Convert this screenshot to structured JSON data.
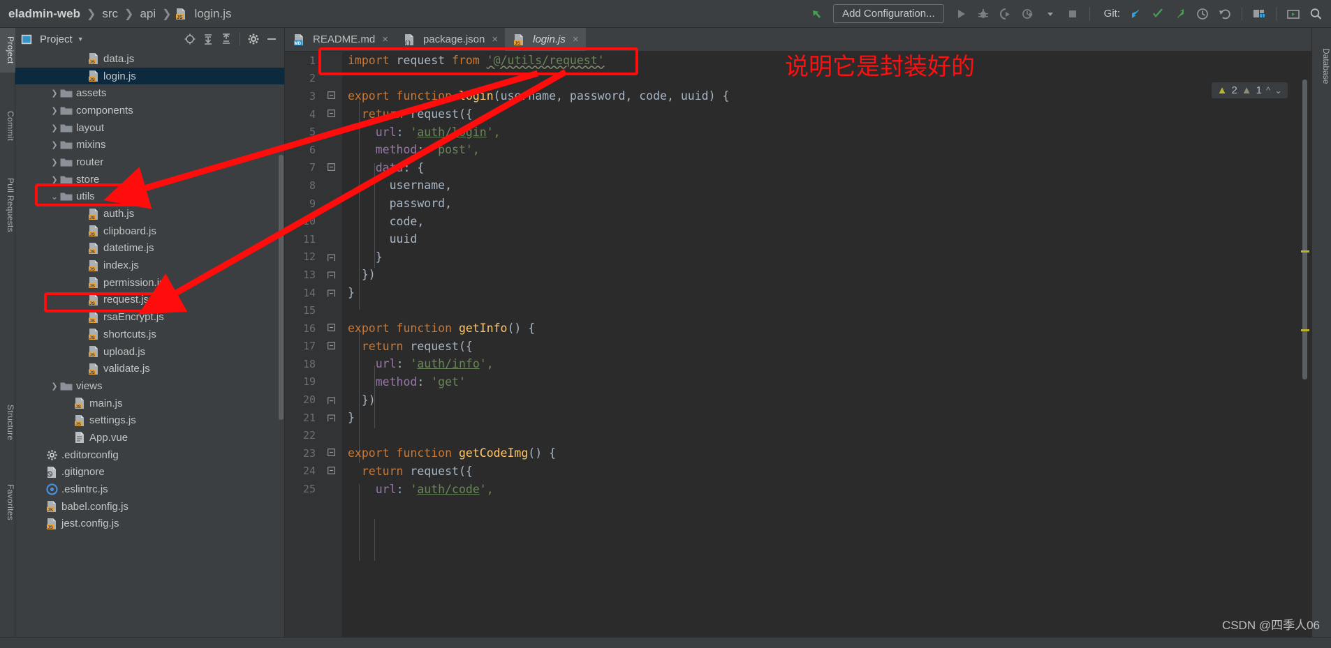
{
  "window": {
    "breadcrumb": [
      "eladmin-web",
      "src",
      "api",
      "login.js"
    ],
    "breadcrumb_file_icon": "js-file-icon"
  },
  "toolbar": {
    "back_icon": "green-arrow-up-left-icon",
    "add_configuration": "Add Configuration...",
    "run_icon": "run-play-icon",
    "debug_icon": "debug-bug-icon",
    "run_coverage_icon": "run-with-coverage-icon",
    "profile_icon": "profiler-icon",
    "dropdown_icon": "chevron-down-icon",
    "stop_icon": "stop-square-icon",
    "git_label": "Git:",
    "git_update_icon": "update-project-blue-arrow-icon",
    "git_commit_icon": "commit-green-check-icon",
    "git_push_icon": "push-green-arrow-icon",
    "history_icon": "history-clock-icon",
    "rollback_icon": "rollback-undo-icon",
    "layout_icon": "layout-windows-icon",
    "terminal_icon": "terminal-screen-icon",
    "search_icon": "search-magnifier-icon"
  },
  "left_tool_strip": [
    {
      "label": "Project",
      "active": true
    },
    {
      "label": "Commit",
      "active": false
    },
    {
      "label": "Pull Requests",
      "active": false
    },
    {
      "label": "Structure",
      "active": false
    },
    {
      "label": "Favorites",
      "active": false
    }
  ],
  "right_tool_strip": [
    {
      "label": "Database"
    }
  ],
  "project_panel": {
    "title": "Project",
    "title_icon": "project-window-icon",
    "caret_icon": "chevron-down-icon",
    "actions": [
      {
        "name": "select-opened-file-icon",
        "glyph": "locate"
      },
      {
        "name": "expand-all-icon",
        "glyph": "expand"
      },
      {
        "name": "collapse-all-icon",
        "glyph": "collapse"
      },
      {
        "name": "settings-gear-icon",
        "glyph": "gear"
      },
      {
        "name": "hide-panel-icon",
        "glyph": "minus"
      }
    ]
  },
  "tree": [
    {
      "label": "data.js",
      "icon": "js-file-icon",
      "indent": 4,
      "arrow": "none",
      "selected": false
    },
    {
      "label": "login.js",
      "icon": "js-file-icon",
      "indent": 4,
      "arrow": "none",
      "selected": true
    },
    {
      "label": "assets",
      "icon": "folder-icon",
      "indent": 2,
      "arrow": "right",
      "selected": false
    },
    {
      "label": "components",
      "icon": "folder-icon",
      "indent": 2,
      "arrow": "right",
      "selected": false
    },
    {
      "label": "layout",
      "icon": "folder-icon",
      "indent": 2,
      "arrow": "right",
      "selected": false
    },
    {
      "label": "mixins",
      "icon": "folder-icon",
      "indent": 2,
      "arrow": "right",
      "selected": false
    },
    {
      "label": "router",
      "icon": "folder-icon",
      "indent": 2,
      "arrow": "right",
      "selected": false
    },
    {
      "label": "store",
      "icon": "folder-icon",
      "indent": 2,
      "arrow": "right",
      "selected": false
    },
    {
      "label": "utils",
      "icon": "folder-icon",
      "indent": 2,
      "arrow": "down",
      "selected": false
    },
    {
      "label": "auth.js",
      "icon": "js-file-icon",
      "indent": 4,
      "arrow": "none",
      "selected": false
    },
    {
      "label": "clipboard.js",
      "icon": "js-file-icon",
      "indent": 4,
      "arrow": "none",
      "selected": false
    },
    {
      "label": "datetime.js",
      "icon": "js-file-icon",
      "indent": 4,
      "arrow": "none",
      "selected": false
    },
    {
      "label": "index.js",
      "icon": "js-file-icon",
      "indent": 4,
      "arrow": "none",
      "selected": false
    },
    {
      "label": "permission.js",
      "icon": "js-file-icon",
      "indent": 4,
      "arrow": "none",
      "selected": false
    },
    {
      "label": "request.js",
      "icon": "js-file-icon",
      "indent": 4,
      "arrow": "none",
      "selected": false
    },
    {
      "label": "rsaEncrypt.js",
      "icon": "js-file-icon",
      "indent": 4,
      "arrow": "none",
      "selected": false
    },
    {
      "label": "shortcuts.js",
      "icon": "js-file-icon",
      "indent": 4,
      "arrow": "none",
      "selected": false
    },
    {
      "label": "upload.js",
      "icon": "js-file-icon",
      "indent": 4,
      "arrow": "none",
      "selected": false
    },
    {
      "label": "validate.js",
      "icon": "js-file-icon",
      "indent": 4,
      "arrow": "none",
      "selected": false
    },
    {
      "label": "views",
      "icon": "folder-icon",
      "indent": 2,
      "arrow": "right",
      "selected": false
    },
    {
      "label": "main.js",
      "icon": "js-file-icon",
      "indent": 3,
      "arrow": "none",
      "selected": false
    },
    {
      "label": "settings.js",
      "icon": "js-file-icon",
      "indent": 3,
      "arrow": "none",
      "selected": false
    },
    {
      "label": "App.vue",
      "icon": "vue-file-icon",
      "indent": 3,
      "arrow": "none",
      "selected": false
    },
    {
      "label": ".editorconfig",
      "icon": "config-gear-icon",
      "indent": 1,
      "arrow": "none",
      "selected": false
    },
    {
      "label": ".gitignore",
      "icon": "gitignore-icon",
      "indent": 1,
      "arrow": "none",
      "selected": false
    },
    {
      "label": ".eslintrc.js",
      "icon": "eslint-icon",
      "indent": 1,
      "arrow": "none",
      "selected": false
    },
    {
      "label": "babel.config.js",
      "icon": "js-file-icon",
      "indent": 1,
      "arrow": "none",
      "selected": false
    },
    {
      "label": "jest.config.js",
      "icon": "js-file-icon",
      "indent": 1,
      "arrow": "none",
      "selected": false
    }
  ],
  "editor_tabs": [
    {
      "label": "README.md",
      "icon": "md-file-icon",
      "active": false,
      "close": "×"
    },
    {
      "label": "package.json",
      "icon": "json-file-icon",
      "active": false,
      "close": "×"
    },
    {
      "label": "login.js",
      "icon": "js-file-icon",
      "active": true,
      "close": "×"
    }
  ],
  "inspections": {
    "warning_icon": "warning-triangle-yellow-icon",
    "warning_count": "2",
    "weak_warning_icon": "warning-triangle-grey-icon",
    "weak_warning_count": "1",
    "prev_icon": "chevron-up-icon",
    "next_icon": "chevron-down-icon"
  },
  "code": {
    "language": "javascript",
    "lines": [
      {
        "n": "1",
        "fold": "",
        "tokens": [
          {
            "t": "import ",
            "c": "kw"
          },
          {
            "t": "request ",
            "c": "id"
          },
          {
            "t": "from ",
            "c": "kw"
          },
          {
            "t": "'@/utils/request'",
            "c": "wavy"
          }
        ]
      },
      {
        "n": "2",
        "fold": "",
        "tokens": []
      },
      {
        "n": "3",
        "fold": "-",
        "tokens": [
          {
            "t": "export function ",
            "c": "kw"
          },
          {
            "t": "login",
            "c": "fn"
          },
          {
            "t": "(",
            "c": "punc"
          },
          {
            "t": "username, password, code, uuid",
            "c": "param"
          },
          {
            "t": ") {",
            "c": "punc"
          }
        ]
      },
      {
        "n": "4",
        "fold": "-",
        "tokens": [
          {
            "t": "  ",
            "c": "id"
          },
          {
            "t": "return ",
            "c": "kw"
          },
          {
            "t": "request({",
            "c": "id"
          }
        ]
      },
      {
        "n": "5",
        "fold": "",
        "tokens": [
          {
            "t": "    ",
            "c": "id"
          },
          {
            "t": "url",
            "c": "prop"
          },
          {
            "t": ": ",
            "c": "punc"
          },
          {
            "t": "'",
            "c": "str"
          },
          {
            "t": "auth/login",
            "c": "link"
          },
          {
            "t": "',",
            "c": "str"
          }
        ]
      },
      {
        "n": "6",
        "fold": "",
        "tokens": [
          {
            "t": "    ",
            "c": "id"
          },
          {
            "t": "method",
            "c": "prop"
          },
          {
            "t": ": ",
            "c": "punc"
          },
          {
            "t": "'post',",
            "c": "str"
          }
        ]
      },
      {
        "n": "7",
        "fold": "-",
        "tokens": [
          {
            "t": "    ",
            "c": "id"
          },
          {
            "t": "data",
            "c": "prop"
          },
          {
            "t": ": {",
            "c": "punc"
          }
        ]
      },
      {
        "n": "8",
        "fold": "",
        "tokens": [
          {
            "t": "      username,",
            "c": "id"
          }
        ]
      },
      {
        "n": "9",
        "fold": "",
        "tokens": [
          {
            "t": "      password,",
            "c": "id"
          }
        ]
      },
      {
        "n": "10",
        "fold": "",
        "tokens": [
          {
            "t": "      code,",
            "c": "id"
          }
        ]
      },
      {
        "n": "11",
        "fold": "",
        "tokens": [
          {
            "t": "      uuid",
            "c": "id"
          }
        ]
      },
      {
        "n": "12",
        "fold": "+",
        "tokens": [
          {
            "t": "    }",
            "c": "punc"
          }
        ]
      },
      {
        "n": "13",
        "fold": "+",
        "tokens": [
          {
            "t": "  })",
            "c": "punc"
          }
        ]
      },
      {
        "n": "14",
        "fold": "+",
        "tokens": [
          {
            "t": "}",
            "c": "punc"
          }
        ]
      },
      {
        "n": "15",
        "fold": "",
        "tokens": []
      },
      {
        "n": "16",
        "fold": "-",
        "tokens": [
          {
            "t": "export function ",
            "c": "kw"
          },
          {
            "t": "getInfo",
            "c": "fn"
          },
          {
            "t": "() {",
            "c": "punc"
          }
        ]
      },
      {
        "n": "17",
        "fold": "-",
        "tokens": [
          {
            "t": "  ",
            "c": "id"
          },
          {
            "t": "return ",
            "c": "kw"
          },
          {
            "t": "request({",
            "c": "id"
          }
        ]
      },
      {
        "n": "18",
        "fold": "",
        "tokens": [
          {
            "t": "    ",
            "c": "id"
          },
          {
            "t": "url",
            "c": "prop"
          },
          {
            "t": ": ",
            "c": "punc"
          },
          {
            "t": "'",
            "c": "str"
          },
          {
            "t": "auth/info",
            "c": "link"
          },
          {
            "t": "',",
            "c": "str"
          }
        ]
      },
      {
        "n": "19",
        "fold": "",
        "tokens": [
          {
            "t": "    ",
            "c": "id"
          },
          {
            "t": "method",
            "c": "prop"
          },
          {
            "t": ": ",
            "c": "punc"
          },
          {
            "t": "'get'",
            "c": "str"
          }
        ]
      },
      {
        "n": "20",
        "fold": "+",
        "tokens": [
          {
            "t": "  })",
            "c": "punc"
          }
        ]
      },
      {
        "n": "21",
        "fold": "+",
        "tokens": [
          {
            "t": "}",
            "c": "punc"
          }
        ]
      },
      {
        "n": "22",
        "fold": "",
        "tokens": []
      },
      {
        "n": "23",
        "fold": "-",
        "tokens": [
          {
            "t": "export function ",
            "c": "kw"
          },
          {
            "t": "getCodeImg",
            "c": "fn"
          },
          {
            "t": "() {",
            "c": "punc"
          }
        ]
      },
      {
        "n": "24",
        "fold": "-",
        "tokens": [
          {
            "t": "  ",
            "c": "id"
          },
          {
            "t": "return ",
            "c": "kw"
          },
          {
            "t": "request({",
            "c": "id"
          }
        ]
      },
      {
        "n": "25",
        "fold": "",
        "tokens": [
          {
            "t": "    ",
            "c": "id"
          },
          {
            "t": "url",
            "c": "prop"
          },
          {
            "t": ": ",
            "c": "punc"
          },
          {
            "t": "'",
            "c": "str"
          },
          {
            "t": "auth/code",
            "c": "link"
          },
          {
            "t": "',",
            "c": "str"
          }
        ]
      }
    ]
  },
  "annotations": {
    "note_text": "说明它是封装好的",
    "note_color": "#ff0f0f",
    "boxes": [
      {
        "name": "import-line-highlight"
      },
      {
        "name": "utils-folder-highlight"
      },
      {
        "name": "request-js-highlight"
      }
    ],
    "arrows": [
      {
        "name": "arrow-to-utils-folder"
      },
      {
        "name": "arrow-to-request-js"
      }
    ],
    "watermark": "CSDN @四季人06"
  }
}
